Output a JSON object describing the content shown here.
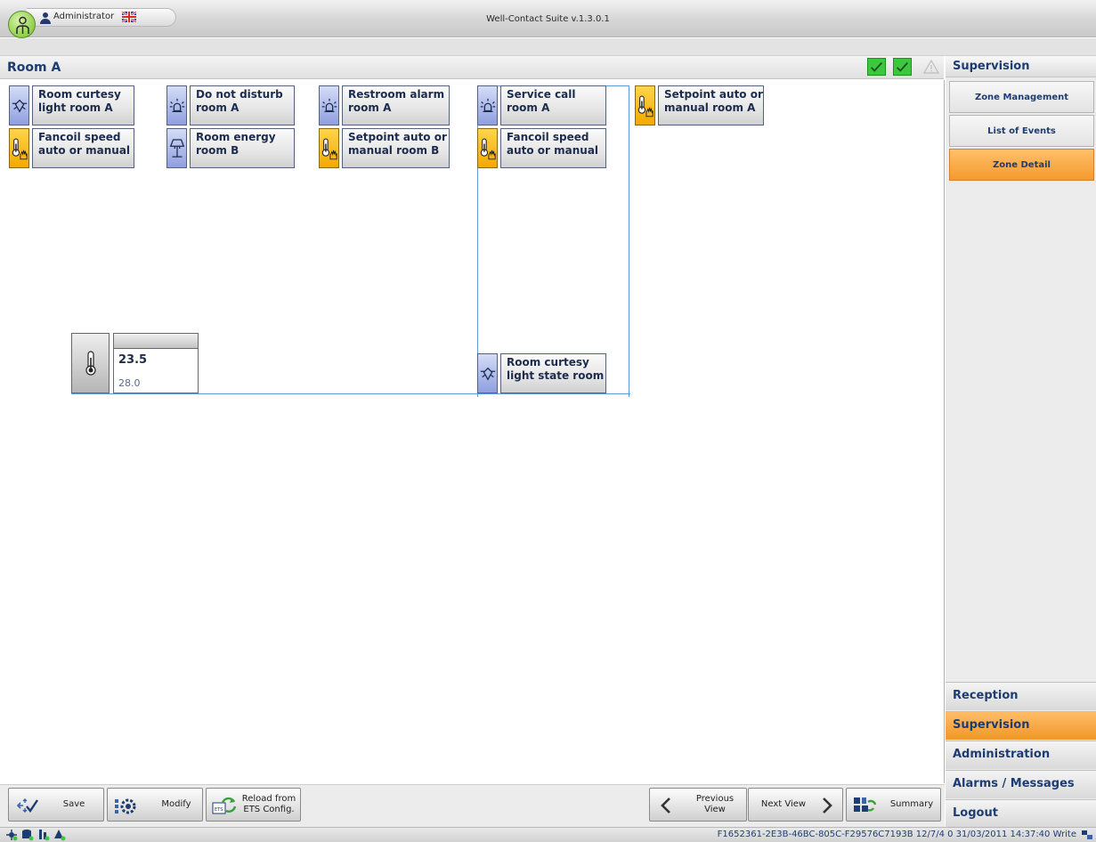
{
  "window": {
    "title": "Well-Contact Suite v.1.3.0.1",
    "user": "Administrator"
  },
  "room": {
    "title": "Room A"
  },
  "controls": [
    {
      "label": "Room curtesy\nlight room A",
      "icon": "courtesy-light-icon"
    },
    {
      "label": "Do not disturb\nroom A",
      "icon": "lamp-signal-icon"
    },
    {
      "label": "Restroom alarm\nroom A",
      "icon": "lamp-signal-icon"
    },
    {
      "label": "Service call\nroom A",
      "icon": "lamp-signal-icon"
    },
    {
      "label": "Setpoint auto or\nmanual room A",
      "icon": "thermometer-hand-icon"
    },
    {
      "label": "Fancoil speed\nauto or manual",
      "icon": "thermometer-hand-icon"
    },
    {
      "label": "Room energy\nroom B",
      "icon": "floor-lamp-icon"
    },
    {
      "label": "Setpoint auto or\nmanual room B",
      "icon": "thermometer-hand-icon"
    },
    {
      "label": "Fancoil speed\nauto or manual",
      "icon": "thermometer-hand-icon"
    },
    {
      "label": "Room curtesy\nlight state room",
      "icon": "courtesy-light-icon"
    }
  ],
  "thermostat": {
    "current": "23.5",
    "setpoint": "28.0"
  },
  "bottom_buttons": {
    "save": "Save",
    "modify": "Modify",
    "reload": "Reload from\nETS Config.",
    "previous": "Previous\nView",
    "next": "Next View",
    "summary": "Summary"
  },
  "sidebar": {
    "header": "Supervision",
    "buttons": [
      "Zone Management",
      "List of Events",
      "Zone Detail"
    ],
    "active_button": "Zone Detail",
    "nav": [
      "Reception",
      "Supervision",
      "Administration",
      "Alarms / Messages",
      "Logout"
    ],
    "active_nav": "Supervision"
  },
  "status": {
    "text": "F1652361-2E3B-46BC-805C-F29576C7193B 12/7/4 0 31/03/2011 14:37:40 Write"
  },
  "colors": {
    "accent_orange": "#f59a2e",
    "title_blue": "#1d3d72",
    "ok_green": "#3cc83c",
    "tile_blue": "#8f9fe0",
    "tile_yellow": "#f3a900"
  }
}
